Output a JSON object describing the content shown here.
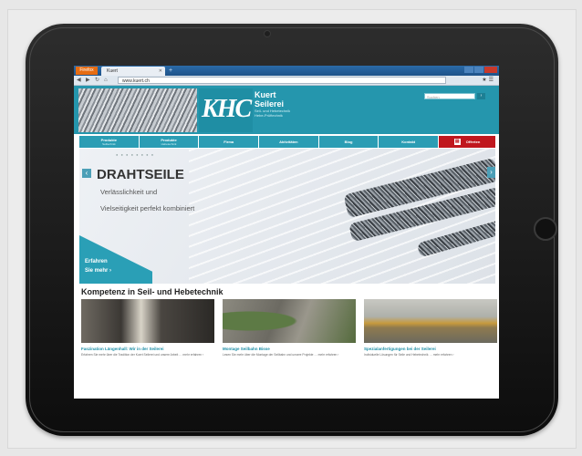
{
  "browser": {
    "menu_button": "Firefox",
    "tab_title": "Kuert",
    "url": "www.kuert.ch"
  },
  "header": {
    "logo": "KHC",
    "brand_line1": "Kuert",
    "brand_line2": "Seilerei",
    "brand_line3": "Seil- und Hebetechnik",
    "brand_line4": "Hebe-Prüftechnik",
    "search_placeholder": "Suchen"
  },
  "nav": {
    "items": [
      {
        "label": "Produkte",
        "sub": "Seiltechnik"
      },
      {
        "label": "Produkte",
        "sub": "Hebetechnik"
      },
      {
        "label": "Firma",
        "sub": ""
      },
      {
        "label": "Aktivitäten",
        "sub": ""
      },
      {
        "label": "Blog",
        "sub": ""
      },
      {
        "label": "Kontakt",
        "sub": ""
      }
    ],
    "offer": "Offerten"
  },
  "hero": {
    "title": "DRAHTSEILE",
    "line1": "Verlässlichkeit und",
    "line2": "Vielseitigkeit perfekt kombiniert",
    "cta1": "Erfahren",
    "cta2": "Sie mehr ›"
  },
  "section_title": "Kompetenz in Seil- und Hebetechnik",
  "cards": [
    {
      "title": "Faszination Längenhall: Wir in der Seilerei",
      "text": "Erfahren Sie mehr über die Tradition der Kuert Seilerei und unsere Arbeit … mehr erfahren ›"
    },
    {
      "title": "Montage Seilbahn Bisse",
      "text": "Lesen Sie mehr über die Montage der Seilbahn und unsere Projekte … mehr erfahren ›"
    },
    {
      "title": "Spezialanfertigungen bei der Seilerei",
      "text": "Individuelle Lösungen für Seile und Hebetechnik … mehr erfahren ›"
    }
  ]
}
